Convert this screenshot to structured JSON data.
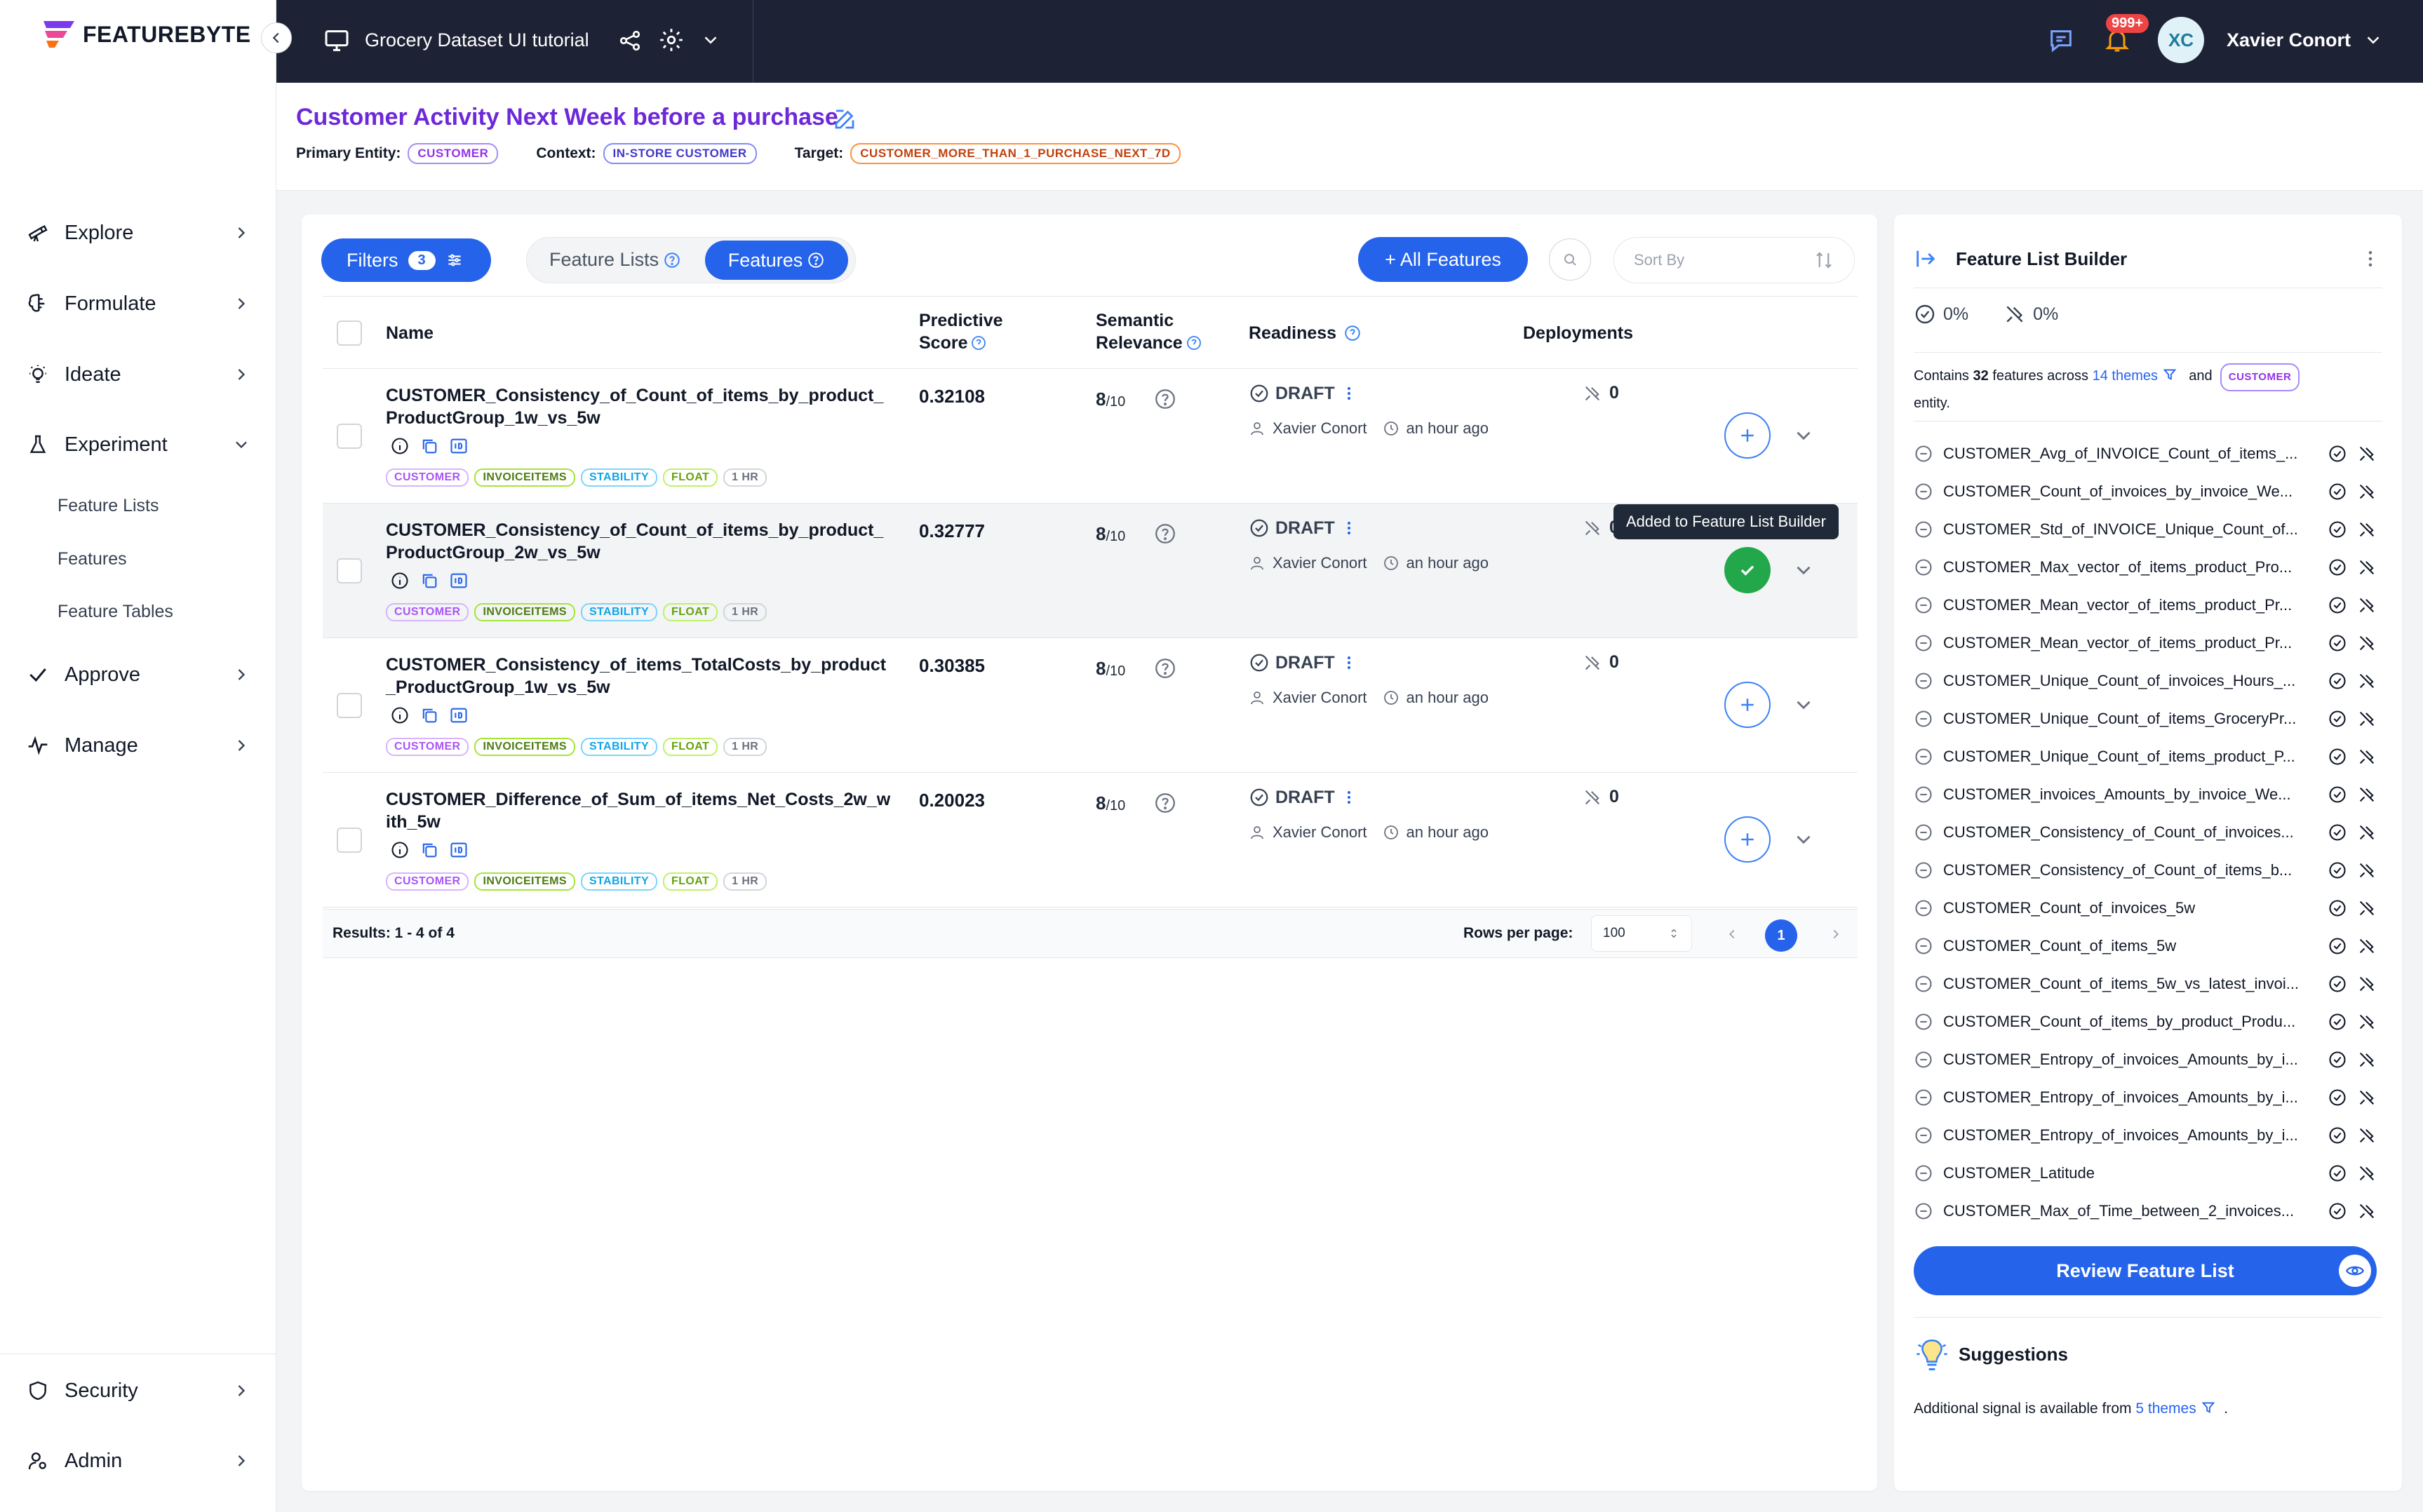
{
  "brand": {
    "logo_text": "FEATUREBYTE"
  },
  "sidebar": {
    "items": [
      {
        "label": "Explore"
      },
      {
        "label": "Formulate"
      },
      {
        "label": "Ideate"
      },
      {
        "label": "Experiment"
      },
      {
        "label": "Approve"
      },
      {
        "label": "Manage"
      }
    ],
    "subitems": [
      {
        "label": "Feature Lists"
      },
      {
        "label": "Features"
      },
      {
        "label": "Feature Tables"
      }
    ],
    "bottom": [
      {
        "label": "Security"
      },
      {
        "label": "Admin"
      }
    ]
  },
  "topbar": {
    "project": "Grocery Dataset UI tutorial",
    "notifications": "999+",
    "user_initials": "XC",
    "user_name": "Xavier Conort"
  },
  "header": {
    "title": "Customer Activity Next Week before a purchase",
    "primary_entity_label": "Primary Entity:",
    "primary_entity": "CUSTOMER",
    "context_label": "Context:",
    "context": "IN-STORE CUSTOMER",
    "target_label": "Target:",
    "target": "CUSTOMER_MORE_THAN_1_PURCHASE_NEXT_7D"
  },
  "toolbar": {
    "filters_label": "Filters",
    "filters_count": "3",
    "feature_lists_tab": "Feature Lists",
    "features_tab": "Features",
    "all_features": "+ All Features",
    "sort_placeholder": "Sort By"
  },
  "table": {
    "headers": {
      "name": "Name",
      "predictive_1": "Predictive",
      "predictive_2": "Score",
      "semantic_1": "Semantic",
      "semantic_2": "Relevance",
      "readiness": "Readiness",
      "deployments": "Deployments"
    },
    "rows": [
      {
        "name": "CUSTOMER_Consistency_of_Count_of_items_by_product_ProductGroup_1w_vs_5w",
        "score": "0.32108",
        "relevance": "8",
        "relevance_den": "/10",
        "readiness": "DRAFT",
        "owner": "Xavier Conort",
        "time": "an hour ago",
        "deployments": "0",
        "tags": [
          "CUSTOMER",
          "INVOICEITEMS",
          "STABILITY",
          "FLOAT",
          "1 HR"
        ]
      },
      {
        "name": "CUSTOMER_Consistency_of_Count_of_items_by_product_ProductGroup_2w_vs_5w",
        "score": "0.32777",
        "relevance": "8",
        "relevance_den": "/10",
        "readiness": "DRAFT",
        "owner": "Xavier Conort",
        "time": "an hour ago",
        "deployments": "0",
        "tags": [
          "CUSTOMER",
          "INVOICEITEMS",
          "STABILITY",
          "FLOAT",
          "1 HR"
        ]
      },
      {
        "name": "CUSTOMER_Consistency_of_items_TotalCosts_by_product_ProductGroup_1w_vs_5w",
        "score": "0.30385",
        "relevance": "8",
        "relevance_den": "/10",
        "readiness": "DRAFT",
        "owner": "Xavier Conort",
        "time": "an hour ago",
        "deployments": "0",
        "tags": [
          "CUSTOMER",
          "INVOICEITEMS",
          "STABILITY",
          "FLOAT",
          "1 HR"
        ]
      },
      {
        "name": "CUSTOMER_Difference_of_Sum_of_items_Net_Costs_2w_with_5w",
        "score": "0.20023",
        "relevance": "8",
        "relevance_den": "/10",
        "readiness": "DRAFT",
        "owner": "Xavier Conort",
        "time": "an hour ago",
        "deployments": "0",
        "tags": [
          "CUSTOMER",
          "INVOICEITEMS",
          "STABILITY",
          "FLOAT",
          "1 HR"
        ]
      }
    ],
    "tooltip": "Added to Feature List Builder",
    "results": "Results: 1 - 4 of 4",
    "rows_per_page_label": "Rows per page:",
    "rows_per_page": "100",
    "current_page": "1"
  },
  "builder": {
    "title": "Feature List Builder",
    "readiness_pct": "0%",
    "deploy_pct": "0%",
    "contains_prefix": "Contains",
    "count": "32",
    "contains_mid": "features across",
    "themes_link": "14 themes",
    "and": "and",
    "entity_tag": "CUSTOMER",
    "entity_suffix": "entity.",
    "features": [
      "CUSTOMER_Avg_of_INVOICE_Count_of_items_...",
      "CUSTOMER_Count_of_invoices_by_invoice_We...",
      "CUSTOMER_Std_of_INVOICE_Unique_Count_of...",
      "CUSTOMER_Max_vector_of_items_product_Pro...",
      "CUSTOMER_Mean_vector_of_items_product_Pr...",
      "CUSTOMER_Mean_vector_of_items_product_Pr...",
      "CUSTOMER_Unique_Count_of_invoices_Hours_...",
      "CUSTOMER_Unique_Count_of_items_GroceryPr...",
      "CUSTOMER_Unique_Count_of_items_product_P...",
      "CUSTOMER_invoices_Amounts_by_invoice_We...",
      "CUSTOMER_Consistency_of_Count_of_invoices...",
      "CUSTOMER_Consistency_of_Count_of_items_b...",
      "CUSTOMER_Count_of_invoices_5w",
      "CUSTOMER_Count_of_items_5w",
      "CUSTOMER_Count_of_items_5w_vs_latest_invoi...",
      "CUSTOMER_Count_of_items_by_product_Produ...",
      "CUSTOMER_Entropy_of_invoices_Amounts_by_i...",
      "CUSTOMER_Entropy_of_invoices_Amounts_by_i...",
      "CUSTOMER_Entropy_of_invoices_Amounts_by_i...",
      "CUSTOMER_Latitude",
      "CUSTOMER_Max_of_Time_between_2_invoices..."
    ],
    "review_button": "Review Feature List",
    "suggestions_title": "Suggestions",
    "suggestions_prefix": "Additional signal is available from",
    "suggestions_link": "5 themes",
    "suggestions_suffix": "."
  },
  "colors": {
    "primary": "#2563eb",
    "topbar": "#1e2235",
    "title_purple": "#6d28d9",
    "success": "#22a84a",
    "badge_red": "#ef4444"
  },
  "icons": [
    "telescope-icon",
    "brain-icon",
    "bulb-icon",
    "flask-icon",
    "check-icon",
    "pulse-icon",
    "shield-icon",
    "admin-user-icon",
    "monitor-icon",
    "share-icon",
    "gear-icon",
    "chat-icon",
    "bell-icon",
    "edit-icon",
    "search-icon",
    "sort-icon",
    "info-icon",
    "copy-icon",
    "id-icon",
    "help-icon",
    "user-icon",
    "clock-icon",
    "no-deploy-icon",
    "plus-icon",
    "chevron-down-icon",
    "eye-icon",
    "filter-icon"
  ]
}
